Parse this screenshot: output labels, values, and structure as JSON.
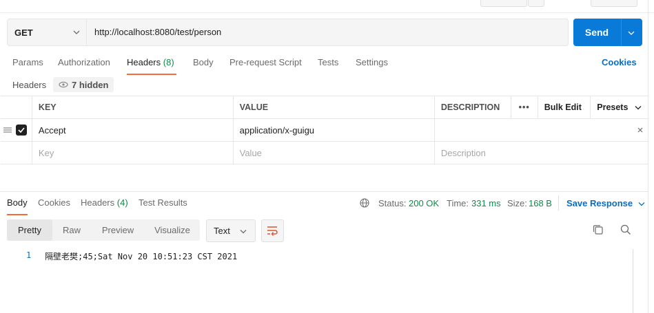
{
  "request": {
    "method": "GET",
    "url": "http://localhost:8080/test/person",
    "send_label": "Send"
  },
  "tabs": [
    {
      "label": "Params"
    },
    {
      "label": "Authorization"
    },
    {
      "label": "Headers",
      "count": "(8)"
    },
    {
      "label": "Body"
    },
    {
      "label": "Pre-request Script"
    },
    {
      "label": "Tests"
    },
    {
      "label": "Settings"
    }
  ],
  "cookies_link": "Cookies",
  "headers_section": {
    "label": "Headers",
    "hidden_label": "7 hidden",
    "columns": {
      "key": "KEY",
      "value": "VALUE",
      "description": "DESCRIPTION"
    },
    "bulk_edit": "Bulk Edit",
    "presets": "Presets",
    "rows": [
      {
        "key": "Accept",
        "value": "application/x-guigu",
        "description": ""
      }
    ],
    "placeholders": {
      "key": "Key",
      "value": "Value",
      "description": "Description"
    }
  },
  "response": {
    "tabs": [
      {
        "label": "Body"
      },
      {
        "label": "Cookies"
      },
      {
        "label": "Headers",
        "count": "(4)"
      },
      {
        "label": "Test Results"
      }
    ],
    "status_label": "Status:",
    "status_value": "200 OK",
    "time_label": "Time:",
    "time_value": "331 ms",
    "size_label": "Size:",
    "size_value": "168 B",
    "save_label": "Save Response",
    "formats": [
      "Pretty",
      "Raw",
      "Preview",
      "Visualize"
    ],
    "type_select": "Text",
    "lines": [
      {
        "num": "1",
        "text": "隔壁老樊;45;Sat Nov 20 10:51:23 CST 2021"
      }
    ]
  },
  "colors": {
    "accent": "#f26b3a",
    "send": "#0a7ad9",
    "link": "#0a6dc2",
    "success": "#0f8a4b"
  }
}
